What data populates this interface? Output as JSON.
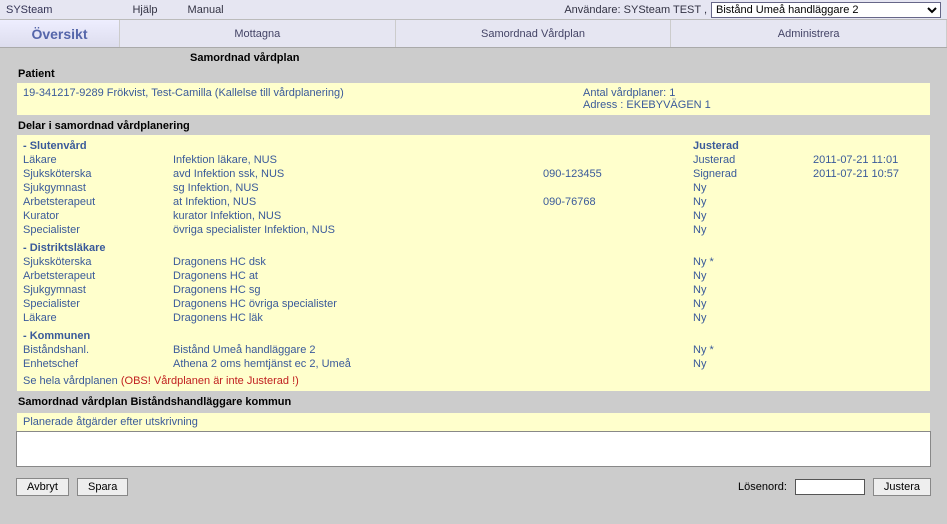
{
  "top": {
    "appname": "SYSteam",
    "menu": {
      "help": "Hjälp",
      "manual": "Manual"
    },
    "user_label": "Användare: SYSteam TEST ,",
    "role_selected": "Bistånd Umeå handläggare 2"
  },
  "tabs": {
    "overview": "Översikt",
    "received": "Mottagna",
    "careplan": "Samordnad Vårdplan",
    "admin": "Administrera"
  },
  "page_title": "Samordnad vårdplan",
  "patient_label": "Patient",
  "patient": {
    "id_name": "19-341217-9289  Frökvist, Test-Camilla  (Kallelse till vårdplanering)",
    "plans_label": "Antal vårdplaner:  1",
    "address": "Adress : EKEBYVÄGEN 1"
  },
  "parts_label": "Delar i samordnad vårdplanering",
  "hdr": {
    "status": "Justerad"
  },
  "groups": {
    "sluten": "- Slutenvård",
    "distrikt": "- Distriktsläkare",
    "kommun": "- Kommunen"
  },
  "rows": {
    "s1": {
      "role": "Läkare",
      "who": "Infektion läkare, NUS",
      "phone": "",
      "status": "Justerad",
      "ts": "2011-07-21 11:01"
    },
    "s2": {
      "role": "Sjuksköterska",
      "who": "avd Infektion ssk, NUS",
      "phone": "090-123455",
      "status": "Signerad",
      "ts": "2011-07-21 10:57"
    },
    "s3": {
      "role": "Sjukgymnast",
      "who": "sg Infektion, NUS",
      "phone": "",
      "status": "Ny",
      "ts": ""
    },
    "s4": {
      "role": "Arbetsterapeut",
      "who": "at Infektion, NUS",
      "phone": "090-76768",
      "status": "Ny",
      "ts": ""
    },
    "s5": {
      "role": "Kurator",
      "who": "kurator Infektion, NUS",
      "phone": "",
      "status": "Ny",
      "ts": ""
    },
    "s6": {
      "role": "Specialister",
      "who": "övriga specialister Infektion, NUS",
      "phone": "",
      "status": "Ny",
      "ts": ""
    },
    "d1": {
      "role": "Sjuksköterska",
      "who": "Dragonens HC dsk",
      "phone": "",
      "status": "Ny *",
      "ts": ""
    },
    "d2": {
      "role": "Arbetsterapeut",
      "who": "Dragonens HC at",
      "phone": "",
      "status": "Ny",
      "ts": ""
    },
    "d3": {
      "role": "Sjukgymnast",
      "who": "Dragonens HC sg",
      "phone": "",
      "status": "Ny",
      "ts": ""
    },
    "d4": {
      "role": "Specialister",
      "who": "Dragonens HC övriga specialister",
      "phone": "",
      "status": "Ny",
      "ts": ""
    },
    "d5": {
      "role": "Läkare",
      "who": "Dragonens HC läk",
      "phone": "",
      "status": "Ny",
      "ts": ""
    },
    "k1": {
      "role": "Biståndshanl.",
      "who": "Bistånd Umeå handläggare 2",
      "phone": "",
      "status": "Ny *",
      "ts": ""
    },
    "k2": {
      "role": "Enhetschef",
      "who": "Athena 2 oms hemtjänst ec 2, Umeå",
      "phone": "",
      "status": "Ny",
      "ts": ""
    }
  },
  "fullplan": {
    "link": "Se hela vårdplanen",
    "warn": "(OBS! Vårdplanen är inte Justerad !)"
  },
  "bottom_section_label": "Samordnad vårdplan Biståndshandläggare kommun",
  "planned_label": "Planerade åtgärder efter utskrivning",
  "planned_value": "",
  "buttons": {
    "cancel": "Avbryt",
    "save": "Spara",
    "password_label": "Lösenord:",
    "adjust": "Justera"
  }
}
